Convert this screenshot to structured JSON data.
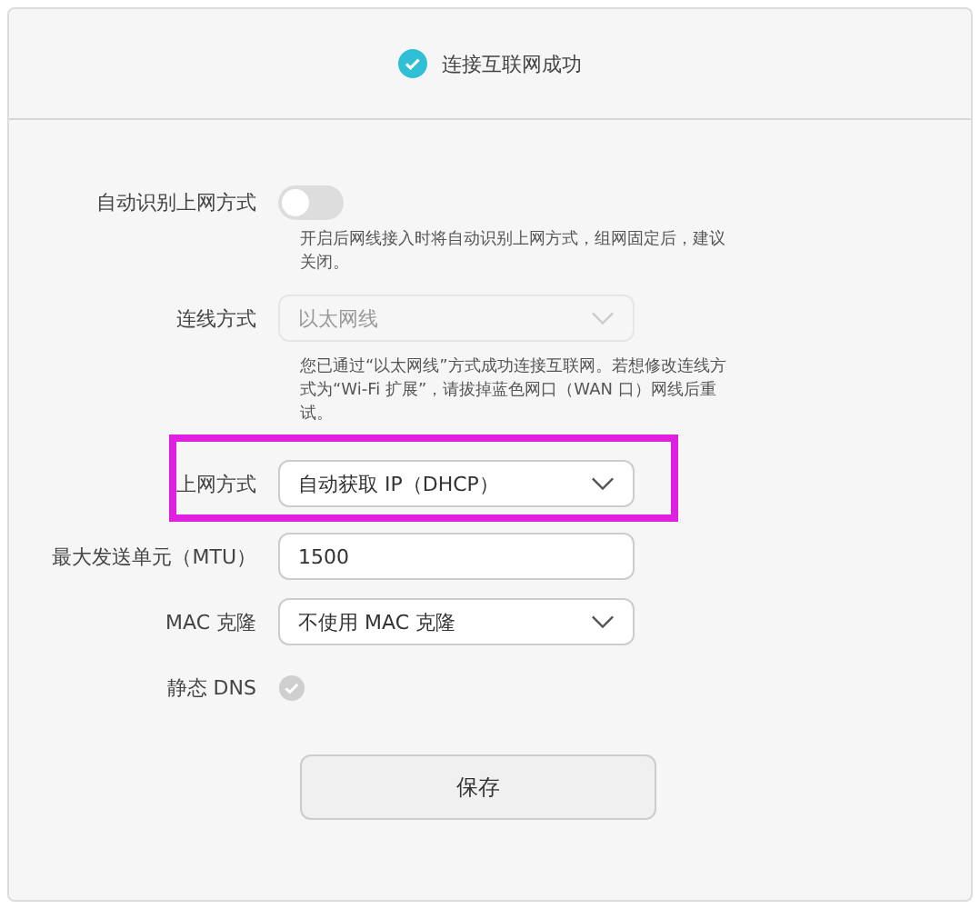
{
  "status": {
    "text": "连接互联网成功"
  },
  "fields": [
    {
      "kind": "toggle",
      "label": "自动识别上网方式",
      "on": false,
      "hint": "开启后网线接入时将自动识别上网方式，组网固定后，建议关闭。"
    },
    {
      "kind": "select",
      "label": "连线方式",
      "value": "以太网线",
      "disabled": true,
      "highlighted": false,
      "hint": "您已通过“以太网线”方式成功连接互联网。若想修改连线方式为“Wi-Fi 扩展”，请拔掉蓝色网口（WAN 口）网线后重试。"
    },
    {
      "kind": "select",
      "label": "上网方式",
      "value": "自动获取 IP（DHCP）",
      "disabled": false,
      "highlighted": true
    },
    {
      "kind": "text",
      "label": "最大发送单元（MTU）",
      "value": "1500"
    },
    {
      "kind": "select",
      "label": "MAC 克隆",
      "value": "不使用 MAC 克隆",
      "disabled": false,
      "highlighted": false
    },
    {
      "kind": "check",
      "label": "静态 DNS",
      "checked": true,
      "disabled": true
    }
  ],
  "save_button": "保存"
}
